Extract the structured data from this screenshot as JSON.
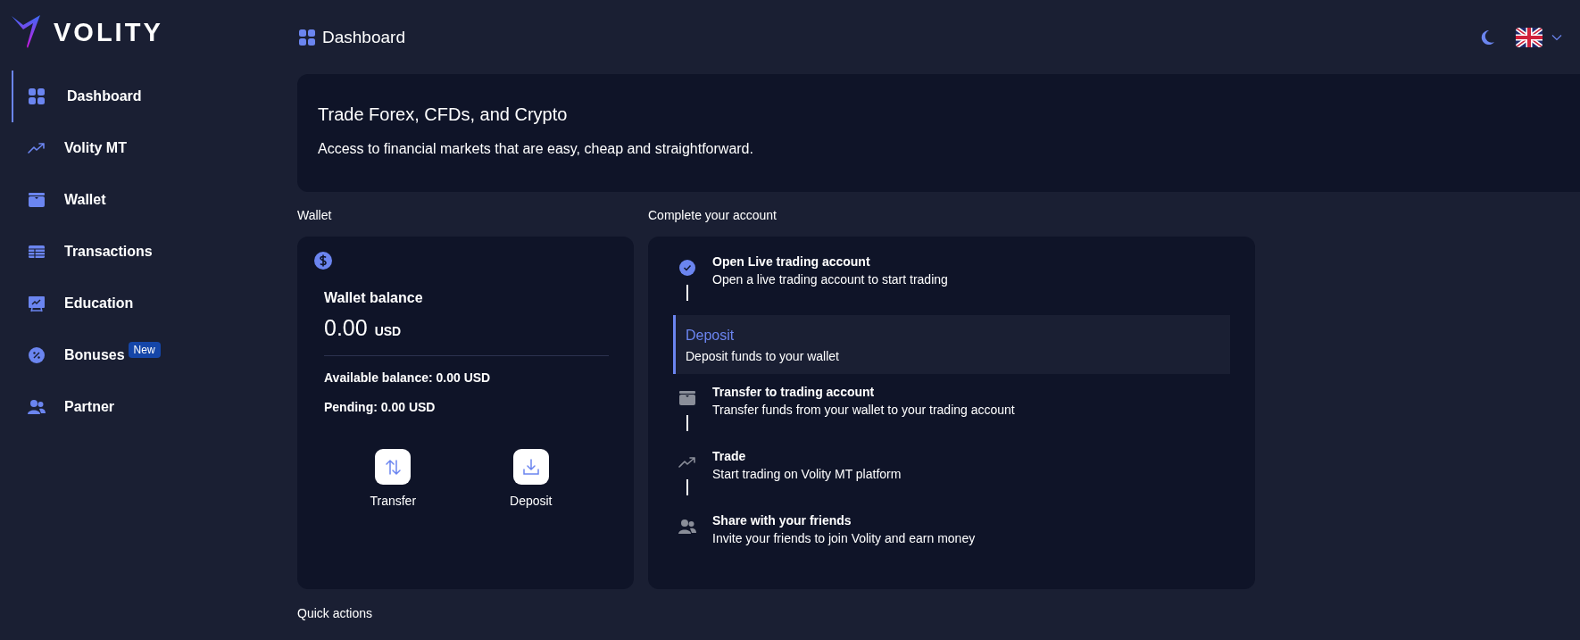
{
  "brand": {
    "name": "VOLITY"
  },
  "sidebar": {
    "items": [
      {
        "label": "Dashboard",
        "kind": "grid",
        "selected": true
      },
      {
        "label": "Volity MT",
        "kind": "trend",
        "selected": false
      },
      {
        "label": "Wallet",
        "kind": "wallet",
        "selected": false
      },
      {
        "label": "Transactions",
        "kind": "table",
        "selected": false
      },
      {
        "label": "Education",
        "kind": "board",
        "selected": false
      },
      {
        "label": "Bonuses",
        "kind": "percent",
        "selected": false,
        "badge": "New"
      },
      {
        "label": "Partner",
        "kind": "people",
        "selected": false
      }
    ]
  },
  "header": {
    "title": "Dashboard"
  },
  "banner": {
    "title": "Trade Forex, CFDs, and Crypto",
    "text": "Access to financial markets that are easy, cheap and straightforward."
  },
  "wallet": {
    "section_title": "Wallet",
    "title": "Wallet balance",
    "amount": "0.00",
    "currency": "USD",
    "available": "Available balance: 0.00 USD",
    "pending": "Pending: 0.00 USD",
    "actions": [
      {
        "label": "Transfer",
        "kind": "transfer"
      },
      {
        "label": "Deposit",
        "kind": "deposit"
      }
    ]
  },
  "complete_account": {
    "section_title": "Complete your account",
    "steps": [
      {
        "title": "Open Live trading account",
        "text": "Open a live trading account to start trading",
        "kind": "check",
        "selected": false
      },
      {
        "title": "Deposit",
        "text": "Deposit funds to your wallet",
        "kind": "none",
        "selected": true
      },
      {
        "title": "Transfer to trading account",
        "text": "Transfer funds from your wallet to your trading account",
        "kind": "wallet",
        "selected": false
      },
      {
        "title": "Trade",
        "text": "Start trading on Volity MT platform",
        "kind": "trend",
        "selected": false
      },
      {
        "title": "Share with your friends",
        "text": "Invite your friends to join Volity and earn money",
        "kind": "people",
        "selected": false
      }
    ]
  },
  "quick_actions": {
    "section_title": "Quick actions"
  }
}
